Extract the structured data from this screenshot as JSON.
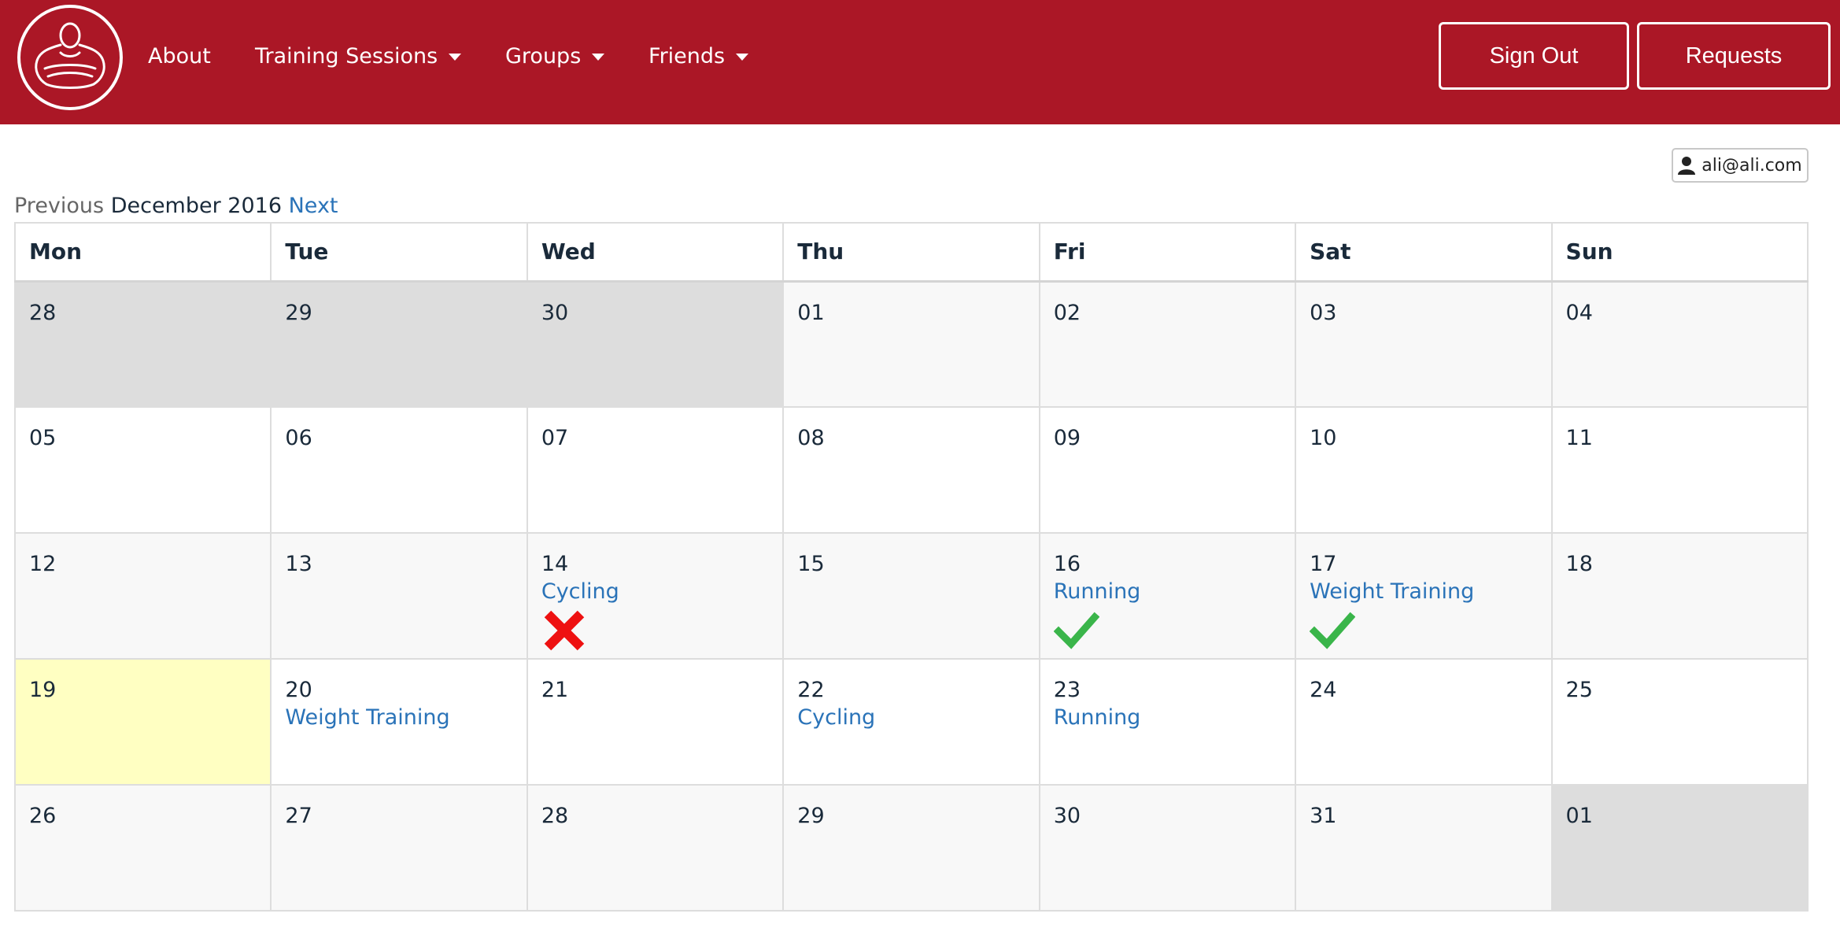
{
  "nav": {
    "about": "About",
    "training_sessions": "Training Sessions",
    "groups": "Groups",
    "friends": "Friends",
    "sign_out": "Sign Out",
    "requests": "Requests"
  },
  "user": {
    "email": "ali@ali.com",
    "icon": "user-icon"
  },
  "month_nav": {
    "previous": "Previous",
    "current": "December 2016",
    "next": "Next"
  },
  "weekdays": [
    "Mon",
    "Tue",
    "Wed",
    "Thu",
    "Fri",
    "Sat",
    "Sun"
  ],
  "weeks": [
    [
      {
        "day": "28",
        "other": true
      },
      {
        "day": "29",
        "other": true
      },
      {
        "day": "30",
        "other": true
      },
      {
        "day": "01"
      },
      {
        "day": "02"
      },
      {
        "day": "03"
      },
      {
        "day": "04"
      }
    ],
    [
      {
        "day": "05"
      },
      {
        "day": "06"
      },
      {
        "day": "07"
      },
      {
        "day": "08"
      },
      {
        "day": "09"
      },
      {
        "day": "10"
      },
      {
        "day": "11"
      }
    ],
    [
      {
        "day": "12"
      },
      {
        "day": "13"
      },
      {
        "day": "14",
        "event": "Cycling",
        "status": "missed"
      },
      {
        "day": "15"
      },
      {
        "day": "16",
        "event": "Running",
        "status": "done"
      },
      {
        "day": "17",
        "event": "Weight Training",
        "status": "done"
      },
      {
        "day": "18"
      }
    ],
    [
      {
        "day": "19",
        "today": true
      },
      {
        "day": "20",
        "event": "Weight Training"
      },
      {
        "day": "21"
      },
      {
        "day": "22",
        "event": "Cycling"
      },
      {
        "day": "23",
        "event": "Running"
      },
      {
        "day": "24"
      },
      {
        "day": "25"
      }
    ],
    [
      {
        "day": "26"
      },
      {
        "day": "27"
      },
      {
        "day": "28"
      },
      {
        "day": "29"
      },
      {
        "day": "30"
      },
      {
        "day": "31"
      },
      {
        "day": "01",
        "other": true
      }
    ]
  ],
  "colors": {
    "navbar": "#ab1726",
    "link": "#2a73b8",
    "today": "#ffffc2",
    "other_month": "#dddddd",
    "check": "#3ab54a",
    "cross": "#ee1111"
  }
}
